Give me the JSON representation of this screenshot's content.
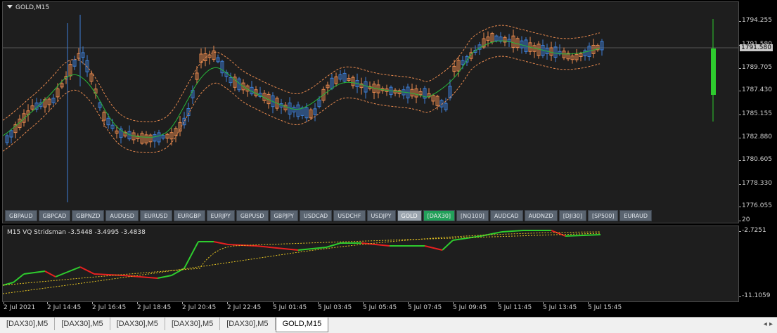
{
  "chart": {
    "title": "GOLD,M15",
    "current_price": "1791.580"
  },
  "price_axis": [
    "1794.255",
    "1791.580",
    "1789.705",
    "1787.430",
    "1785.155",
    "1782.880",
    "1780.605",
    "1778.330",
    "1776.055"
  ],
  "indicator": {
    "label": "M15 VQ Stridsman -3.5448 -3.4995 -3.4838",
    "top_value": "20",
    "axis": [
      "-2.7251",
      "-11.1059"
    ]
  },
  "time_axis": [
    "2 Jul 2021",
    "2 Jul 14:45",
    "2 Jul 16:45",
    "2 Jul 18:45",
    "2 Jul 20:45",
    "2 Jul 22:45",
    "5 Jul 01:45",
    "5 Jul 03:45",
    "5 Jul 05:45",
    "5 Jul 07:45",
    "5 Jul 09:45",
    "5 Jul 11:45",
    "5 Jul 13:45",
    "5 Jul 15:45"
  ],
  "symbols": [
    "GBPAUD",
    "GBPCAD",
    "GBPNZD",
    "AUDUSD",
    "EURUSD",
    "EURGBP",
    "EURJPY",
    "GBPUSD",
    "GBPJPY",
    "USDCAD",
    "USDCHF",
    "USDJPY",
    "GOLD",
    "[DAX30]",
    "[NQ100]",
    "AUDCAD",
    "AUDNZD",
    "[DJI30]",
    "[SP500]",
    "EURAUD"
  ],
  "active_symbol": "GOLD",
  "highlight_symbol": "[DAX30]",
  "tabs": [
    "[DAX30],M5",
    "[DAX30],M5",
    "[DAX30],M5",
    "[DAX30],M5",
    "[DAX30],M5",
    "GOLD,M15"
  ],
  "colors": {
    "bull": "#3d7fd6",
    "bear": "#e98a4e",
    "ma": "#27b83a",
    "band": "#e98a4e",
    "indicator_up": "#2ecc2e",
    "indicator_down": "#e82020",
    "signal": "#e5c422",
    "volume_bar": "#2ecc2e"
  }
}
